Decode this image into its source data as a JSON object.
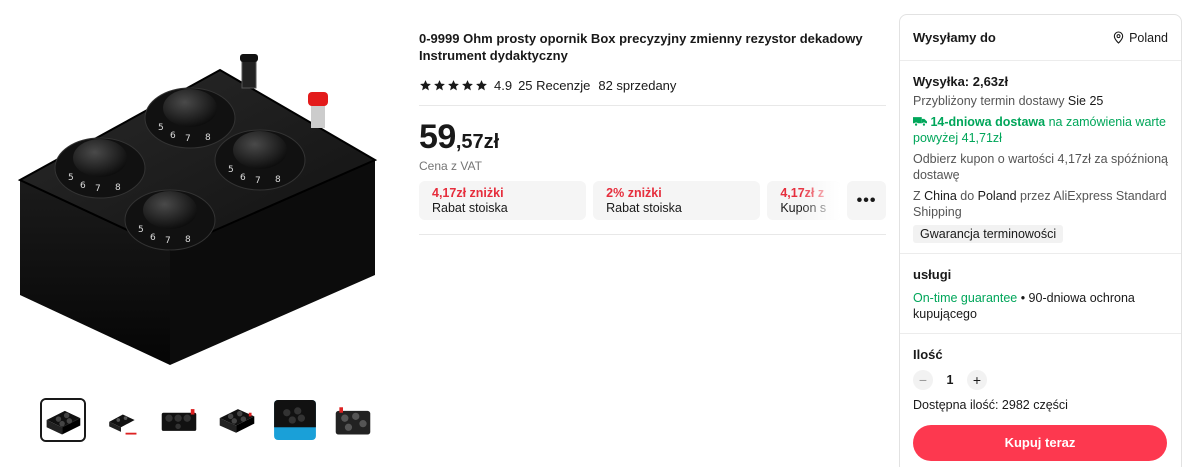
{
  "product": {
    "title": "0-9999 Ohm prosty opornik Box precyzyjny zmienny rezystor dekadowy Instrument dydaktyczny",
    "rating": "4.9",
    "reviews": "25 Recenzje",
    "sold": "82 sprzedany",
    "price_int": "59",
    "price_dec": ",57zł",
    "vat": "Cena z VAT"
  },
  "coupons": [
    {
      "title": "4,17zł zniżki",
      "sub": "Rabat stoiska"
    },
    {
      "title": "2% zniżki",
      "sub": "Rabat stoiska"
    },
    {
      "title": "4,17zł z",
      "sub": "Kupon s"
    }
  ],
  "more_label": "•••",
  "panel": {
    "ship_label": "Wysyłamy do",
    "destination": "Poland",
    "shipping_title": "Wysyłka: 2,63zł",
    "delivery_prefix": "Przybliżony termin dostawy ",
    "delivery_date": "Sie 25",
    "fast_delivery": "14-dniowa dostawa",
    "fast_delivery_rest": " na zamówienia warte powyżej 41,71zł",
    "coupon_note": "Odbierz kupon o wartości 4,17zł za spóźnioną dostawę",
    "route_from_prefix": "Z ",
    "route_from": "China",
    "route_mid": " do ",
    "route_to": "Poland",
    "route_rest": " przez AliExpress Standard Shipping",
    "guarantee_tag": "Gwarancja terminowości",
    "services_title": "usługi",
    "service_green": "On-time guarantee",
    "service_rest": " • 90-dniowa ochrona kupującego",
    "qty_title": "Ilość",
    "qty_minus": "−",
    "qty_value": "1",
    "qty_plus": "+",
    "available": "Dostępna ilość: 2982 części",
    "buy_label": "Kupuj teraz"
  },
  "colors": {
    "accent": "#fd384f",
    "discount": "#e62e3d",
    "green": "#00a65a",
    "star": "#191919"
  },
  "icons": {
    "location": "location-pin-icon",
    "truck": "truck-icon",
    "star": "star-icon"
  }
}
